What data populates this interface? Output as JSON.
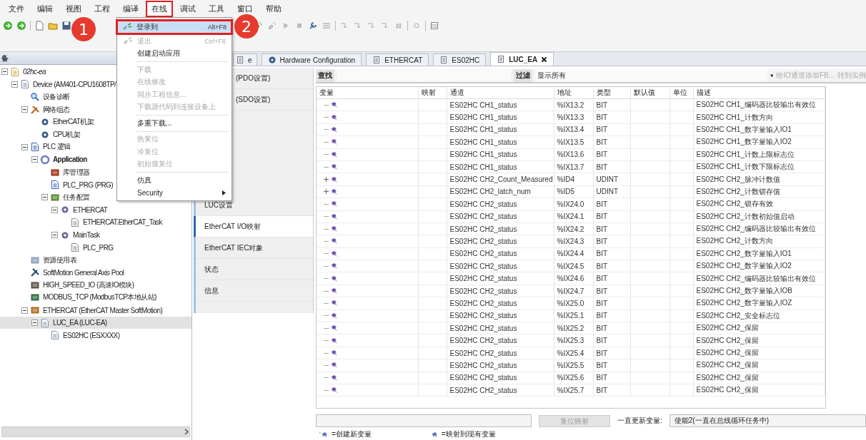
{
  "menubar": [
    {
      "label": "文件",
      "selected": false
    },
    {
      "label": "编辑",
      "selected": false
    },
    {
      "label": "视图",
      "selected": false
    },
    {
      "label": "工程",
      "selected": false
    },
    {
      "label": "编译",
      "selected": false
    },
    {
      "label": "在线",
      "selected": true
    },
    {
      "label": "调试",
      "selected": false
    },
    {
      "label": "工具",
      "selected": false
    },
    {
      "label": "窗口",
      "selected": false
    },
    {
      "label": "帮助",
      "selected": false
    }
  ],
  "online_menu": {
    "groups": [
      [
        {
          "label": "登录到",
          "shortcut": "Alt+F8",
          "kind": "login",
          "disabled": false,
          "selected": true
        },
        {
          "label": "退出",
          "shortcut": "Ctrl+F8",
          "kind": "logout",
          "disabled": true,
          "selected": false
        },
        {
          "label": "创建启动应用",
          "kind": "command",
          "disabled": false,
          "selected": false
        }
      ],
      [
        {
          "label": "下载",
          "kind": "command",
          "disabled": true,
          "selected": false
        },
        {
          "label": "在线修改",
          "kind": "command",
          "disabled": true,
          "selected": false
        },
        {
          "label": "同步工程信息...",
          "kind": "command",
          "disabled": true,
          "selected": false
        },
        {
          "label": "下载源代码到连接设备上",
          "kind": "command",
          "disabled": true,
          "selected": false
        }
      ],
      [
        {
          "label": "多重下载...",
          "kind": "command",
          "disabled": false,
          "selected": false
        }
      ],
      [
        {
          "label": "热复位",
          "kind": "command",
          "disabled": true,
          "selected": false
        },
        {
          "label": "冷复位",
          "kind": "command",
          "disabled": true,
          "selected": false
        },
        {
          "label": "初始值复位",
          "kind": "command",
          "disabled": true,
          "selected": false
        }
      ],
      [
        {
          "label": "仿真",
          "kind": "command",
          "disabled": false,
          "selected": false
        },
        {
          "label": "Security",
          "kind": "submenu",
          "disabled": false,
          "selected": false
        }
      ]
    ]
  },
  "annotations": [
    {
      "label": "1"
    },
    {
      "label": "2"
    }
  ],
  "tree": {
    "title": "备",
    "nodes": [
      {
        "label": "02hc-ea",
        "kind": "project",
        "expanded": true,
        "selected": false,
        "children": [
          {
            "label": "Device (AM401-CPU1608TP/",
            "kind": "device",
            "expanded": true,
            "selected": false,
            "children": [
              {
                "label": "设备诊断",
                "kind": "diagnostic",
                "selected": false
              },
              {
                "label": "网络组态",
                "kind": "network",
                "expanded": true,
                "selected": false,
                "children": [
                  {
                    "label": "EtherCAT机架",
                    "kind": "rack",
                    "selected": false
                  },
                  {
                    "label": "CPU机架",
                    "kind": "rack",
                    "selected": false
                  }
                ]
              },
              {
                "label": "PLC 逻辑",
                "kind": "plc",
                "expanded": true,
                "selected": false,
                "children": [
                  {
                    "label": "Application",
                    "kind": "application",
                    "expanded": true,
                    "selected": false,
                    "children": [
                      {
                        "label": "库管理器",
                        "kind": "library",
                        "selected": false
                      },
                      {
                        "label": "PLC_PRG (PRG)",
                        "kind": "pou",
                        "selected": false
                      },
                      {
                        "label": "任务配置",
                        "kind": "taskconfig",
                        "expanded": true,
                        "selected": false,
                        "children": [
                          {
                            "label": "ETHERCAT",
                            "kind": "task",
                            "expanded": true,
                            "selected": false,
                            "children": [
                              {
                                "label": "ETHERCAT.EtherCAT_Task",
                                "kind": "call",
                                "selected": false
                              }
                            ]
                          },
                          {
                            "label": "MainTask",
                            "kind": "task",
                            "expanded": true,
                            "selected": false,
                            "children": [
                              {
                                "label": "PLC_PRG",
                                "kind": "call",
                                "selected": false
                              }
                            ]
                          }
                        ]
                      }
                    ]
                  }
                ]
              },
              {
                "label": "资源使用表",
                "kind": "table",
                "selected": false
              },
              {
                "label": "SoftMotion General Axis Pool",
                "kind": "axis",
                "selected": false
              },
              {
                "label": "HIGH_SPEED_IO (高速IO模块)",
                "kind": "module",
                "selected": false
              },
              {
                "label": "MODBUS_TCP (ModbusTCP本地从站)",
                "kind": "modbus",
                "selected": false
              },
              {
                "label": "ETHERCAT (EtherCAT Master SoftMotion)",
                "kind": "master",
                "expanded": true,
                "selected": false,
                "children": [
                  {
                    "label": "LUC_EA (LUC-EA)",
                    "kind": "device",
                    "expanded": true,
                    "selected": true,
                    "children": [
                      {
                        "label": "ES02HC (ESXXXX)",
                        "kind": "device",
                        "selected": false
                      }
                    ]
                  }
                ]
              }
            ]
          }
        ]
      }
    ]
  },
  "editor": {
    "tabs": [
      {
        "label": "e",
        "kind": "device",
        "selected": false
      },
      {
        "label": "Hardware Configuration",
        "kind": "hardware",
        "selected": false
      },
      {
        "label": "ETHERCAT",
        "kind": "device",
        "selected": false
      },
      {
        "label": "ES02HC",
        "kind": "device",
        "selected": false
      },
      {
        "label": "LUC_EA",
        "kind": "device",
        "selected": true
      }
    ],
    "nav": [
      {
        "label": "(PDO设置)",
        "selected": false
      },
      {
        "label": "(SDO设置)",
        "selected": false
      },
      {
        "label": "LUC设置",
        "selected": false
      },
      {
        "label": "EtherCAT I/O映射",
        "selected": true
      },
      {
        "label": "EtherCAT IEC对象",
        "selected": false
      },
      {
        "label": "状态",
        "selected": false
      },
      {
        "label": "信息",
        "selected": false
      }
    ],
    "search": {
      "label": "查找",
      "filter_label": "过滤",
      "filter_value": "显示所有",
      "add_fb": {
        "label": "给IO通道添加FB...",
        "disabled": true
      },
      "goto": {
        "label": "转到实例",
        "disabled": true
      }
    },
    "table": {
      "columns": [
        "变量",
        "映射",
        "通道",
        "地址",
        "类型",
        "默认值",
        "单位",
        "描述"
      ],
      "rows": [
        {
          "kind": "leaf",
          "channel": "ES02HC CH1_status",
          "address": "%IX13.2",
          "type": "BIT",
          "description": "ES02HC CH1_编码器比较输出有效位"
        },
        {
          "kind": "leaf",
          "channel": "ES02HC CH1_status",
          "address": "%IX13.3",
          "type": "BIT",
          "description": "ES02HC CH1_计数方向"
        },
        {
          "kind": "leaf",
          "channel": "ES02HC CH1_status",
          "address": "%IX13.4",
          "type": "BIT",
          "description": "ES02HC CH1_数字量输入IO1"
        },
        {
          "kind": "leaf",
          "channel": "ES02HC CH1_status",
          "address": "%IX13.5",
          "type": "BIT",
          "description": "ES02HC CH1_数字量输入IO2"
        },
        {
          "kind": "leaf",
          "channel": "ES02HC CH1_status",
          "address": "%IX13.6",
          "type": "BIT",
          "description": "ES02HC CH1_计数上限标志位"
        },
        {
          "kind": "leaf",
          "channel": "ES02HC CH1_status",
          "address": "%IX13.7",
          "type": "BIT",
          "description": "ES02HC CH1_计数下限标志位"
        },
        {
          "kind": "group",
          "channel": "ES02HC CH2_Count_Measured",
          "address": "%ID4",
          "type": "UDINT",
          "description": "ES02HC CH2_脉冲计数值"
        },
        {
          "kind": "group",
          "channel": "ES02HC CH2_latch_num",
          "address": "%ID5",
          "type": "UDINT",
          "description": "ES02HC CH2_计数锁存值"
        },
        {
          "kind": "leaf",
          "channel": "ES02HC CH2_status",
          "address": "%IX24.0",
          "type": "BIT",
          "description": "ES02HC CH2_锁存有效"
        },
        {
          "kind": "leaf",
          "channel": "ES02HC CH2_status",
          "address": "%IX24.1",
          "type": "BIT",
          "description": "ES02HC CH2_计数初始值启动"
        },
        {
          "kind": "leaf",
          "channel": "ES02HC CH2_status",
          "address": "%IX24.2",
          "type": "BIT",
          "description": "ES02HC CH2_编码器比较输出有效位"
        },
        {
          "kind": "leaf",
          "channel": "ES02HC CH2_status",
          "address": "%IX24.3",
          "type": "BIT",
          "description": "ES02HC CH2_计数方向"
        },
        {
          "kind": "leaf",
          "channel": "ES02HC CH2_status",
          "address": "%IX24.4",
          "type": "BIT",
          "description": "ES02HC CH2_数字量输入IO1"
        },
        {
          "kind": "leaf",
          "channel": "ES02HC CH2_status",
          "address": "%IX24.5",
          "type": "BIT",
          "description": "ES02HC CH2_数字量输入IO2"
        },
        {
          "kind": "leaf",
          "channel": "ES02HC CH2_status",
          "address": "%IX24.6",
          "type": "BIT",
          "description": "ES02HC CH2_编码器比较输出有效位"
        },
        {
          "kind": "leaf",
          "channel": "ES02HC CH2_status",
          "address": "%IX24.7",
          "type": "BIT",
          "description": "ES02HC CH2_数字量输入IOB"
        },
        {
          "kind": "leaf",
          "channel": "ES02HC CH2_status",
          "address": "%IX25.0",
          "type": "BIT",
          "description": "ES02HC CH2_数字量输入IOZ"
        },
        {
          "kind": "leaf",
          "channel": "ES02HC CH2_status",
          "address": "%IX25.1",
          "type": "BIT",
          "description": "ES02HC CH2_安全标志位"
        },
        {
          "kind": "leaf",
          "channel": "ES02HC CH2_status",
          "address": "%IX25.2",
          "type": "BIT",
          "description": "ES02HC CH2_保留"
        },
        {
          "kind": "leaf",
          "channel": "ES02HC CH2_status",
          "address": "%IX25.3",
          "type": "BIT",
          "description": "ES02HC CH2_保留"
        },
        {
          "kind": "leaf",
          "channel": "ES02HC CH2_status",
          "address": "%IX25.4",
          "type": "BIT",
          "description": "ES02HC CH2_保留"
        },
        {
          "kind": "leaf",
          "channel": "ES02HC CH2_status",
          "address": "%IX25.5",
          "type": "BIT",
          "description": "ES02HC CH2_保留"
        },
        {
          "kind": "leaf",
          "channel": "ES02HC CH2_status",
          "address": "%IX25.6",
          "type": "BIT",
          "description": "ES02HC CH2_保留"
        },
        {
          "kind": "leaf",
          "channel": "ES02HC CH2_status",
          "address": "%IX25.7",
          "type": "BIT",
          "description": "ES02HC CH2_保留"
        }
      ]
    },
    "bottom": {
      "reset_button": {
        "label": "复位映射",
        "disabled": true
      },
      "update_label": "一直更新变量:",
      "update_value": "使能2(一直在总线循环任务中)"
    },
    "legend": [
      {
        "kind": "new",
        "label": "=创建新变量"
      },
      {
        "kind": "existing",
        "label": "=映射到现有变量"
      }
    ]
  }
}
